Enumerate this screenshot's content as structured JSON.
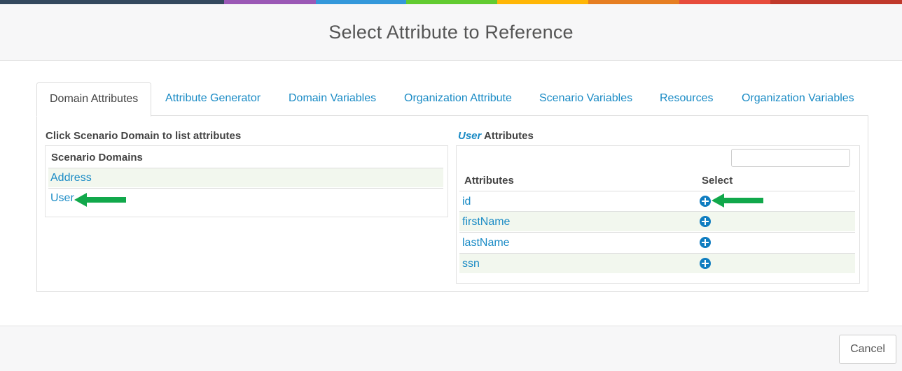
{
  "colors": {
    "topbar": [
      "#34495e",
      "#9b59b6",
      "#3498db",
      "#62cb31",
      "#ffb606",
      "#e67e22",
      "#e74c3c",
      "#c0392b"
    ],
    "link": "#1a8bc5",
    "arrow": "#11a84b",
    "plus": "#0f7dc0"
  },
  "dialog": {
    "title": "Select Attribute to Reference",
    "cancel_label": "Cancel"
  },
  "tabs": [
    {
      "label": "Domain Attributes",
      "active": true
    },
    {
      "label": "Attribute Generator"
    },
    {
      "label": "Domain Variables"
    },
    {
      "label": "Organization Attribute"
    },
    {
      "label": "Scenario Variables"
    },
    {
      "label": "Resources"
    },
    {
      "label": "Organization Variables"
    }
  ],
  "left": {
    "title": "Click Scenario Domain to list attributes",
    "table_header": "Scenario Domains",
    "domains": [
      "Address",
      "User"
    ]
  },
  "right": {
    "title_accent": "User",
    "title_suffix": " Attributes",
    "search_value": "",
    "columns": [
      "Attributes",
      "Select"
    ],
    "attributes": [
      "id",
      "firstName",
      "lastName",
      "ssn"
    ],
    "select_icon": "plus-circle-icon"
  },
  "annotations": {
    "arrow_icon": "green-left-arrow-icon"
  }
}
